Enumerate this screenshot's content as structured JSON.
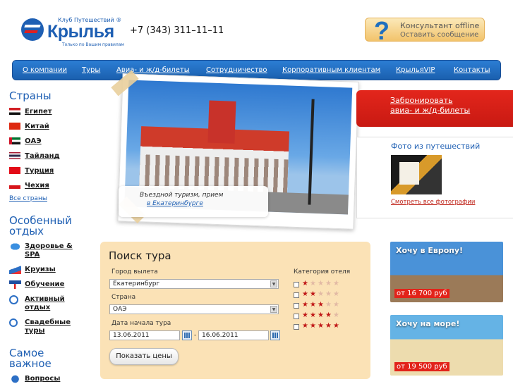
{
  "header": {
    "logo_club": "Клуб Путешествий ®",
    "logo_name": "Крылья",
    "logo_tagline": "Только по Вашим правилам",
    "phone": "+7 (343) 311–11–11",
    "consultant_status": "Консультант offline",
    "consultant_action": "Оставить сообщение"
  },
  "nav": {
    "items": [
      "О компании",
      "Туры",
      "Авиа- и ж/д-билеты",
      "Сотрудничество",
      "Корпоративным клиентам",
      "КрыльяVIP",
      "Контакты"
    ]
  },
  "sidebar": {
    "countries_title": "Страны",
    "countries": [
      "Египет",
      "Китай",
      "ОАЭ",
      "Тайланд",
      "Турция",
      "Чехия"
    ],
    "all_countries": "Все страны",
    "special_title_1": "Особенный",
    "special_title_2": "отдых",
    "special": [
      {
        "line1": "Здоровье &",
        "line2": "SPA",
        "icon": "spa-icon"
      },
      {
        "line1": "Круизы",
        "line2": "",
        "icon": "cruise-icon"
      },
      {
        "line1": "Обучение",
        "line2": "",
        "icon": "education-icon"
      },
      {
        "line1": "Активный",
        "line2": "отдых",
        "icon": "snorkel-icon"
      },
      {
        "line1": "Свадебные",
        "line2": "туры",
        "icon": "rings-icon"
      }
    ],
    "important_title_1": "Самое",
    "important_title_2": "важное",
    "important": [
      "Вопросы"
    ]
  },
  "photo": {
    "caption_line1": "Въездной туризм, прием",
    "caption_line2": "в Екатеринбурге"
  },
  "book": {
    "line1": "Забронировать",
    "line2": "авиа- и ж/д-билеты"
  },
  "gallery": {
    "title": "Фото из путешествий",
    "link": "Смотреть все фотографии"
  },
  "promos": [
    {
      "title": "Хочу в Европу!",
      "price": "от 16 700 руб"
    },
    {
      "title": "Хочу на море!",
      "price": "от 19 500 руб"
    }
  ],
  "search": {
    "title": "Поиск тура",
    "city_label": "Город вылета",
    "city_value": "Екатеринбург",
    "country_label": "Страна",
    "country_value": "ОАЭ",
    "date_label": "Дата начала тура",
    "date_from": "13.06.2011",
    "date_sep": "-",
    "date_to": "16.06.2011",
    "button": "Показать цены",
    "category_label": "Категория отеля",
    "categories": [
      1,
      2,
      3,
      4,
      5
    ],
    "max_stars": 5
  },
  "colors": {
    "brand_blue": "#1e5fb3",
    "nav_blue": "#2c7ed4",
    "red": "#e3261c",
    "search_bg": "#fbe2b6"
  }
}
